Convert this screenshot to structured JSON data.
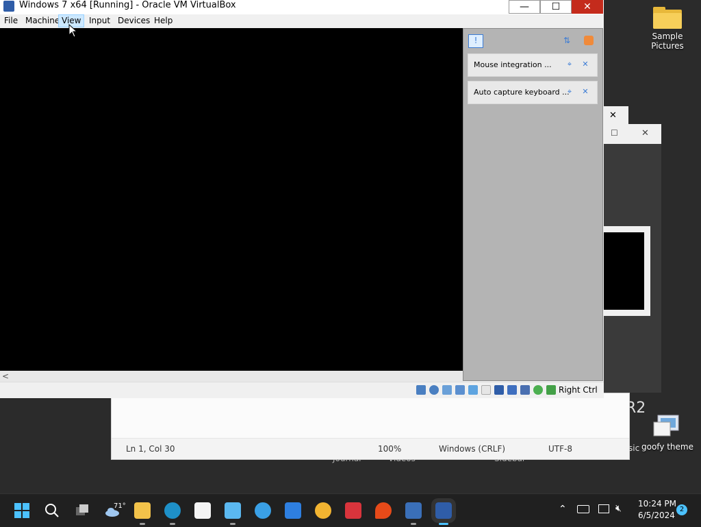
{
  "desktop": {
    "icons": [
      {
        "label": "Sample\nPictures"
      },
      {
        "label": "goofy theme"
      }
    ],
    "behind_texts": [
      "R2",
      "sic",
      "Journal",
      "Videos",
      "Sidebar"
    ]
  },
  "notepad": {
    "status": {
      "position": "Ln 1, Col 30",
      "zoom": "100%",
      "line_ending": "Windows (CRLF)",
      "encoding": "UTF-8"
    }
  },
  "vbox": {
    "title": "Windows 7 x64 [Running] - Oracle VM VirtualBox",
    "caption": {
      "minimize": "—",
      "maximize": "☐",
      "close": "✕"
    },
    "menu": [
      "File",
      "Machine",
      "View",
      "Input",
      "Devices",
      "Help"
    ],
    "active_menu": "View",
    "notifications": [
      {
        "text": "Mouse integration ..."
      },
      {
        "text": "Auto capture keyboard ..."
      }
    ],
    "host_key": "Right Ctrl",
    "accent": "#3a7bd5"
  },
  "taskbar": {
    "weather_temp": "71°",
    "clock_time": "10:24 PM",
    "clock_date": "6/5/2024",
    "notification_count": "2",
    "tray_icons": [
      "chevron-up-icon",
      "keyboard-icon",
      "display-icon",
      "volume-muted-icon"
    ]
  }
}
